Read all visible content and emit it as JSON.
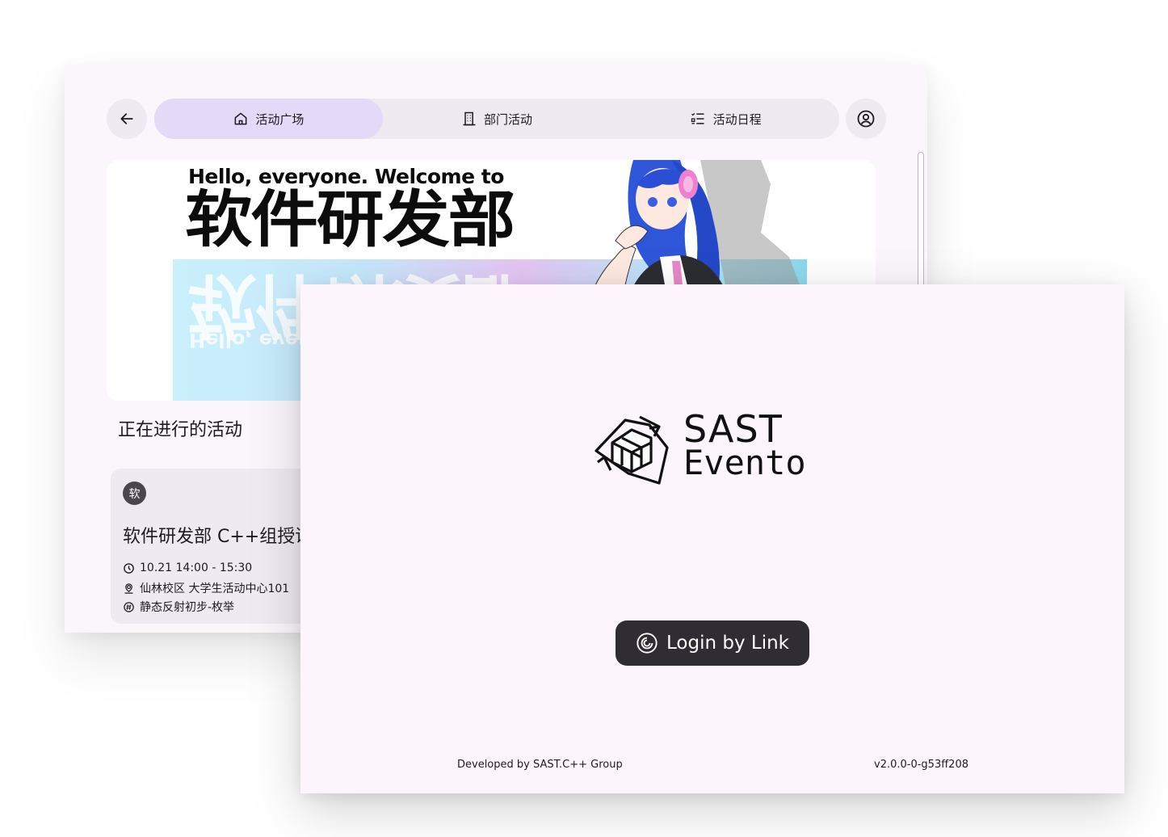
{
  "background_window": {
    "nav": {
      "back_icon": "arrow-left-icon",
      "tabs": [
        {
          "label": "活动广场",
          "icon": "home-icon",
          "active": true
        },
        {
          "label": "部门活动",
          "icon": "building-icon",
          "active": false
        },
        {
          "label": "活动日程",
          "icon": "checklist-icon",
          "active": false
        }
      ],
      "profile_icon": "account-circle-icon"
    },
    "banner": {
      "greeting": "Hello, everyone. Welcome to",
      "title": "软件研发部",
      "reflection_title": "软件研发部",
      "reflection_greeting": "Hello, everyone"
    },
    "section_title": "正在进行的活动",
    "event_card": {
      "avatar_text": "软",
      "title": "软件研发部 C++组授课",
      "time": "10.21 14:00 - 15:30",
      "location": "仙林校区 大学生活动中心101",
      "tag": "静态反射初步-枚举"
    }
  },
  "login_window": {
    "logo": {
      "line1": "SAST",
      "line2": "Evento"
    },
    "login_button": {
      "label": "Login by Link",
      "icon": "link-spiral-icon"
    },
    "footer": {
      "credit": "Developed by SAST.C++ Group",
      "version": "v2.0.0-0-g53ff208"
    }
  },
  "colors": {
    "window_bg": "#fbf5fc",
    "nav_bg": "#efe9f1",
    "active_tab": "#e4d9f7",
    "button_dark": "#2f2c33",
    "text": "#1d1b20"
  }
}
